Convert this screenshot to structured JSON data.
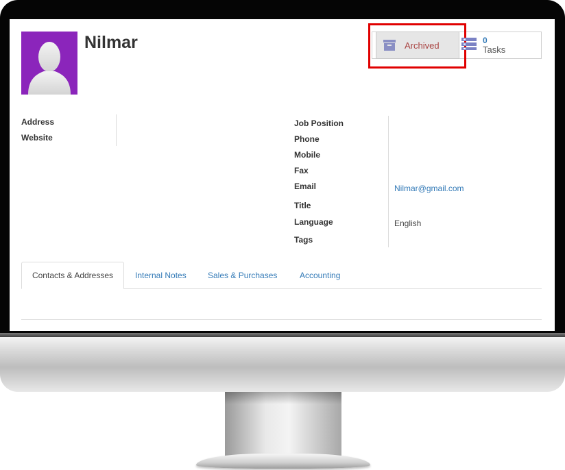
{
  "contact": {
    "name": "Nilmar"
  },
  "stat_buttons": {
    "archive": {
      "label": "Archived",
      "icon": "archive-box-icon"
    },
    "tasks": {
      "count": "0",
      "label": "Tasks",
      "icon": "tasks-list-icon"
    }
  },
  "left_fields": [
    {
      "label": "Address",
      "value": ""
    },
    {
      "label": "Website",
      "value": ""
    }
  ],
  "right_fields": [
    {
      "label": "Job Position",
      "value": ""
    },
    {
      "label": "Phone",
      "value": ""
    },
    {
      "label": "Mobile",
      "value": ""
    },
    {
      "label": "Fax",
      "value": ""
    },
    {
      "label": "Email",
      "value": "Nilmar@gmail.com"
    },
    {
      "label": "Title",
      "value": ""
    },
    {
      "label": "Language",
      "value": "English"
    },
    {
      "label": "Tags",
      "value": ""
    }
  ],
  "tabs": [
    {
      "label": "Contacts & Addresses",
      "active": true
    },
    {
      "label": "Internal Notes",
      "active": false
    },
    {
      "label": "Sales & Purchases",
      "active": false
    },
    {
      "label": "Accounting",
      "active": false
    }
  ],
  "colors": {
    "avatar_bg": "#8b25bb",
    "link": "#337ab7",
    "archived_text": "#a94442",
    "highlight_border": "#e00000"
  }
}
